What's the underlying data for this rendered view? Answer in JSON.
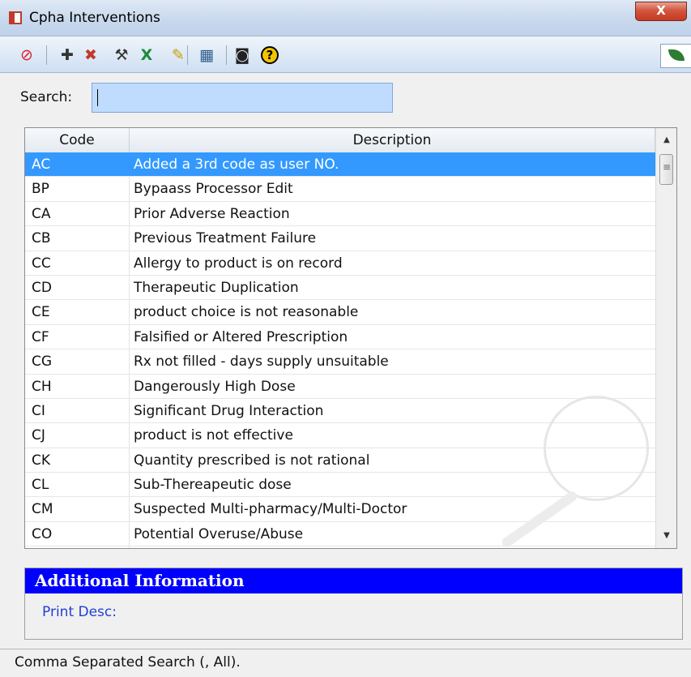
{
  "window": {
    "title": "Cpha Interventions",
    "close_label": "X"
  },
  "toolbar": {
    "icons": [
      {
        "name": "cancel-icon",
        "glyph": "⊘",
        "color": "#d9212b"
      },
      {
        "name": "add-icon",
        "glyph": "✚",
        "color": "#333333"
      },
      {
        "name": "delete-icon",
        "glyph": "✖",
        "color": "#c0392b"
      },
      {
        "name": "tools-icon",
        "glyph": "⚒",
        "color": "#333333"
      },
      {
        "name": "excel-icon",
        "glyph": "X",
        "color": "#1e8a3a"
      },
      {
        "name": "pencil-icon",
        "glyph": "✎",
        "color": "#c7a000"
      },
      {
        "name": "grid-icon",
        "glyph": "▦",
        "color": "#2d5b8c"
      },
      {
        "name": "camera-icon",
        "glyph": "◙",
        "color": "#222222"
      },
      {
        "name": "help-icon",
        "glyph": "?",
        "color": "#000000"
      }
    ],
    "leaf_icon": "leaf-icon"
  },
  "search": {
    "label": "Search:",
    "value": "",
    "placeholder": ""
  },
  "table": {
    "columns": [
      "Code",
      "Description"
    ],
    "selected_index": 0,
    "rows": [
      {
        "code": "AC",
        "description": "Added a 3rd code as user NO."
      },
      {
        "code": "BP",
        "description": "Bypaass Processor Edit"
      },
      {
        "code": "CA",
        "description": "Prior Adverse Reaction"
      },
      {
        "code": "CB",
        "description": "Previous Treatment Failure"
      },
      {
        "code": "CC",
        "description": "Allergy to product is on record"
      },
      {
        "code": "CD",
        "description": "Therapeutic Duplication"
      },
      {
        "code": "CE",
        "description": "product choice is not reasonable"
      },
      {
        "code": "CF",
        "description": "Falsified or Altered Prescription"
      },
      {
        "code": "CG",
        "description": "Rx not filled - days supply unsuitable"
      },
      {
        "code": "CH",
        "description": "Dangerously High Dose"
      },
      {
        "code": "CI",
        "description": "Significant Drug Interaction"
      },
      {
        "code": "CJ",
        "description": "product is not effective"
      },
      {
        "code": "CK",
        "description": "Quantity prescribed is not rational"
      },
      {
        "code": "CL",
        "description": "Sub-Thereapeutic dose"
      },
      {
        "code": "CM",
        "description": "Suspected Multi-pharmacy/Multi-Doctor"
      },
      {
        "code": "CO",
        "description": "Potential Overuse/Abuse"
      }
    ]
  },
  "additional_info": {
    "title": "Additional Information",
    "print_desc_label": "Print Desc:"
  },
  "status": {
    "text": "Comma Separated Search (, All)."
  },
  "colors": {
    "selection": "#3399ff",
    "info_header": "#0000ff",
    "search_bg": "#bfdcff"
  }
}
